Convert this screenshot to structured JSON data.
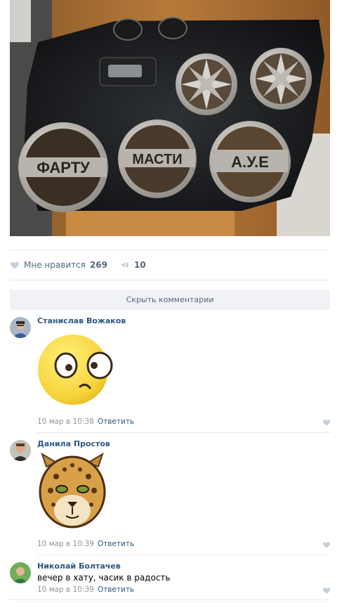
{
  "post": {
    "likes_label": "Мне нравится",
    "likes_count": "269",
    "shares_count": "10",
    "photo_texts": [
      "ФАРТУ",
      "МАСТИ",
      "А.У.Е"
    ]
  },
  "hide_comments_label": "Скрыть комментарии",
  "comments": [
    {
      "author": "Станислав Вожаков",
      "date": "10 мар в 10:38",
      "reply": "Ответить",
      "sticker": "confused-face-sticker"
    },
    {
      "author": "Данила Простов",
      "date": "10 мар в 10:39",
      "reply": "Ответить",
      "sticker": "leopard-sticker"
    },
    {
      "author": "Николай Болтачев",
      "text": "вечер в хату, часик в радость",
      "date": "10 мар в 10:39",
      "reply": "Ответить"
    }
  ],
  "colors": {
    "link": "#2a5885",
    "meta": "#939393",
    "divider": "#e7e8ec",
    "button_bg": "#f0f2f5"
  },
  "icons": {
    "like": "heart-icon",
    "share": "megaphone-icon"
  }
}
